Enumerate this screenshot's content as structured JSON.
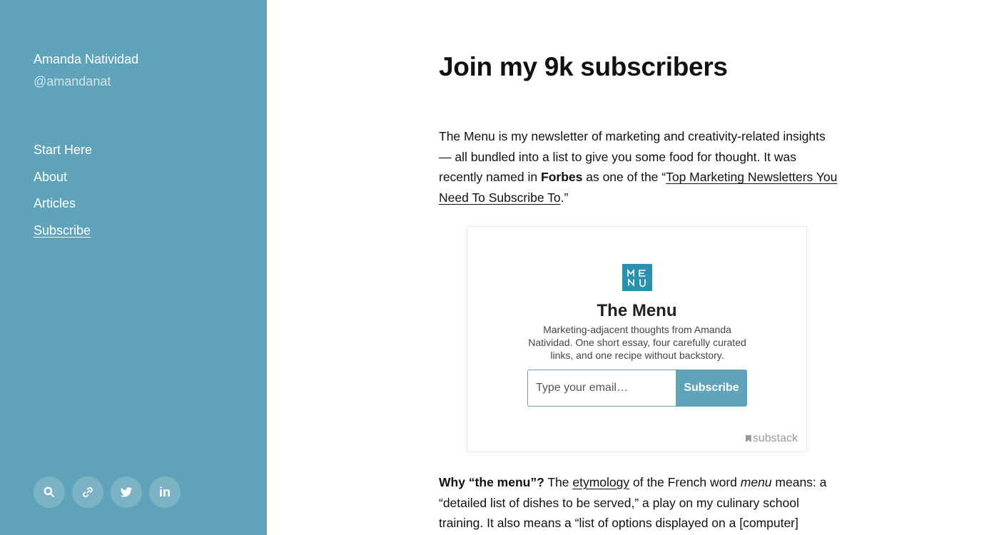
{
  "sidebar": {
    "name": "Amanda Natividad",
    "handle": "@amandanat",
    "nav": [
      {
        "label": "Start Here"
      },
      {
        "label": "About"
      },
      {
        "label": "Articles"
      },
      {
        "label": "Subscribe"
      }
    ],
    "social_icons": [
      "search-icon",
      "link-icon",
      "twitter-icon",
      "linkedin-icon"
    ],
    "linkedin_text": "in"
  },
  "main": {
    "title": "Join my 9k subscribers",
    "para1": {
      "part1": "The Menu is my newsletter of marketing and creativity-related insights — all bundled into a list to give you some food for thought. It was recently named in ",
      "bold": "Forbes",
      "part2": " as one of the “",
      "link": "Top Marketing Newsletters You Need To Subscribe To",
      "part3": ".”"
    },
    "embed": {
      "logo_icon": "the-menu-logo",
      "title": "The Menu",
      "description": "Marketing-adjacent thoughts from Amanda Natividad. One short essay, four carefully curated links, and one recipe without backstory.",
      "email_placeholder": "Type your email…",
      "button_label": "Subscribe",
      "brand": "substack"
    },
    "para2": {
      "bold": "Why “the menu”?",
      "part1": " The ",
      "link": "etymology",
      "part2": " of the French word ",
      "italic": "menu",
      "part3": " means: a “detailed list of dishes to be served,” a play on my culinary school training. It also means a “list of options displayed on a [computer]"
    }
  },
  "colors": {
    "sidebar_bg": "#5ea3b9",
    "accent": "#5ea3b9",
    "logo_bg": "#2b8fae"
  }
}
